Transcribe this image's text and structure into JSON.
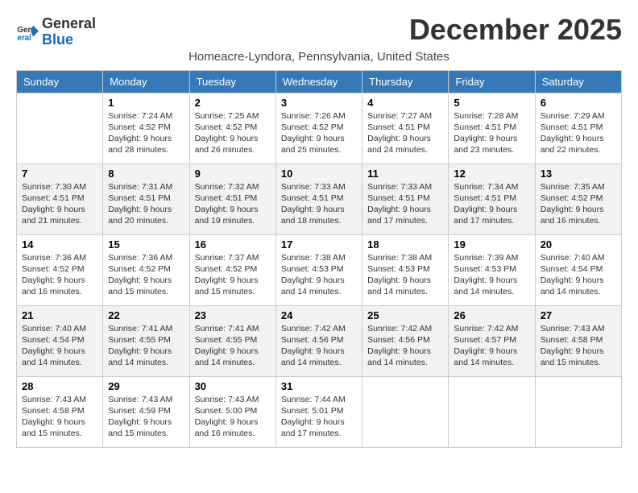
{
  "logo": {
    "general": "General",
    "blue": "Blue"
  },
  "title": "December 2025",
  "location": "Homeacre-Lyndora, Pennsylvania, United States",
  "days_of_week": [
    "Sunday",
    "Monday",
    "Tuesday",
    "Wednesday",
    "Thursday",
    "Friday",
    "Saturday"
  ],
  "weeks": [
    [
      {
        "num": "",
        "info": ""
      },
      {
        "num": "1",
        "info": "Sunrise: 7:24 AM\nSunset: 4:52 PM\nDaylight: 9 hours\nand 28 minutes."
      },
      {
        "num": "2",
        "info": "Sunrise: 7:25 AM\nSunset: 4:52 PM\nDaylight: 9 hours\nand 26 minutes."
      },
      {
        "num": "3",
        "info": "Sunrise: 7:26 AM\nSunset: 4:52 PM\nDaylight: 9 hours\nand 25 minutes."
      },
      {
        "num": "4",
        "info": "Sunrise: 7:27 AM\nSunset: 4:51 PM\nDaylight: 9 hours\nand 24 minutes."
      },
      {
        "num": "5",
        "info": "Sunrise: 7:28 AM\nSunset: 4:51 PM\nDaylight: 9 hours\nand 23 minutes."
      },
      {
        "num": "6",
        "info": "Sunrise: 7:29 AM\nSunset: 4:51 PM\nDaylight: 9 hours\nand 22 minutes."
      }
    ],
    [
      {
        "num": "7",
        "info": "Sunrise: 7:30 AM\nSunset: 4:51 PM\nDaylight: 9 hours\nand 21 minutes."
      },
      {
        "num": "8",
        "info": "Sunrise: 7:31 AM\nSunset: 4:51 PM\nDaylight: 9 hours\nand 20 minutes."
      },
      {
        "num": "9",
        "info": "Sunrise: 7:32 AM\nSunset: 4:51 PM\nDaylight: 9 hours\nand 19 minutes."
      },
      {
        "num": "10",
        "info": "Sunrise: 7:33 AM\nSunset: 4:51 PM\nDaylight: 9 hours\nand 18 minutes."
      },
      {
        "num": "11",
        "info": "Sunrise: 7:33 AM\nSunset: 4:51 PM\nDaylight: 9 hours\nand 17 minutes."
      },
      {
        "num": "12",
        "info": "Sunrise: 7:34 AM\nSunset: 4:51 PM\nDaylight: 9 hours\nand 17 minutes."
      },
      {
        "num": "13",
        "info": "Sunrise: 7:35 AM\nSunset: 4:52 PM\nDaylight: 9 hours\nand 16 minutes."
      }
    ],
    [
      {
        "num": "14",
        "info": "Sunrise: 7:36 AM\nSunset: 4:52 PM\nDaylight: 9 hours\nand 16 minutes."
      },
      {
        "num": "15",
        "info": "Sunrise: 7:36 AM\nSunset: 4:52 PM\nDaylight: 9 hours\nand 15 minutes."
      },
      {
        "num": "16",
        "info": "Sunrise: 7:37 AM\nSunset: 4:52 PM\nDaylight: 9 hours\nand 15 minutes."
      },
      {
        "num": "17",
        "info": "Sunrise: 7:38 AM\nSunset: 4:53 PM\nDaylight: 9 hours\nand 14 minutes."
      },
      {
        "num": "18",
        "info": "Sunrise: 7:38 AM\nSunset: 4:53 PM\nDaylight: 9 hours\nand 14 minutes."
      },
      {
        "num": "19",
        "info": "Sunrise: 7:39 AM\nSunset: 4:53 PM\nDaylight: 9 hours\nand 14 minutes."
      },
      {
        "num": "20",
        "info": "Sunrise: 7:40 AM\nSunset: 4:54 PM\nDaylight: 9 hours\nand 14 minutes."
      }
    ],
    [
      {
        "num": "21",
        "info": "Sunrise: 7:40 AM\nSunset: 4:54 PM\nDaylight: 9 hours\nand 14 minutes."
      },
      {
        "num": "22",
        "info": "Sunrise: 7:41 AM\nSunset: 4:55 PM\nDaylight: 9 hours\nand 14 minutes."
      },
      {
        "num": "23",
        "info": "Sunrise: 7:41 AM\nSunset: 4:55 PM\nDaylight: 9 hours\nand 14 minutes."
      },
      {
        "num": "24",
        "info": "Sunrise: 7:42 AM\nSunset: 4:56 PM\nDaylight: 9 hours\nand 14 minutes."
      },
      {
        "num": "25",
        "info": "Sunrise: 7:42 AM\nSunset: 4:56 PM\nDaylight: 9 hours\nand 14 minutes."
      },
      {
        "num": "26",
        "info": "Sunrise: 7:42 AM\nSunset: 4:57 PM\nDaylight: 9 hours\nand 14 minutes."
      },
      {
        "num": "27",
        "info": "Sunrise: 7:43 AM\nSunset: 4:58 PM\nDaylight: 9 hours\nand 15 minutes."
      }
    ],
    [
      {
        "num": "28",
        "info": "Sunrise: 7:43 AM\nSunset: 4:58 PM\nDaylight: 9 hours\nand 15 minutes."
      },
      {
        "num": "29",
        "info": "Sunrise: 7:43 AM\nSunset: 4:59 PM\nDaylight: 9 hours\nand 15 minutes."
      },
      {
        "num": "30",
        "info": "Sunrise: 7:43 AM\nSunset: 5:00 PM\nDaylight: 9 hours\nand 16 minutes."
      },
      {
        "num": "31",
        "info": "Sunrise: 7:44 AM\nSunset: 5:01 PM\nDaylight: 9 hours\nand 17 minutes."
      },
      {
        "num": "",
        "info": ""
      },
      {
        "num": "",
        "info": ""
      },
      {
        "num": "",
        "info": ""
      }
    ]
  ]
}
